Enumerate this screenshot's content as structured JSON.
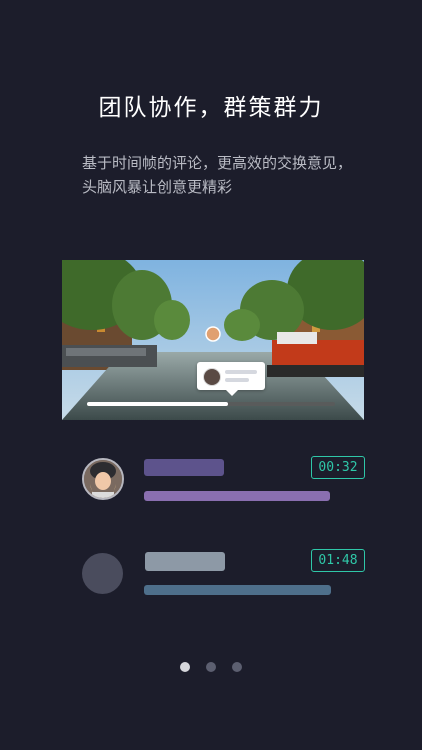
{
  "onboarding": {
    "title": "团队协作，群策群力",
    "subtitle": "基于时间帧的评论，更高效的交换意见，头脑风暴让创意更精彩",
    "video_progress_fraction": 0.57,
    "comments": [
      {
        "timestamp": "00:32",
        "avatar": "user-photo-avatar"
      },
      {
        "timestamp": "01:48",
        "avatar": "placeholder-avatar"
      }
    ],
    "pagination": {
      "total": 3,
      "active_index": 0
    }
  },
  "colors": {
    "background": "#1c1d2b",
    "accent_teal": "#2fc7a8",
    "purple": "#8a6fb0",
    "indigo": "#5d538c",
    "steel_blue": "#4e6f8b"
  }
}
